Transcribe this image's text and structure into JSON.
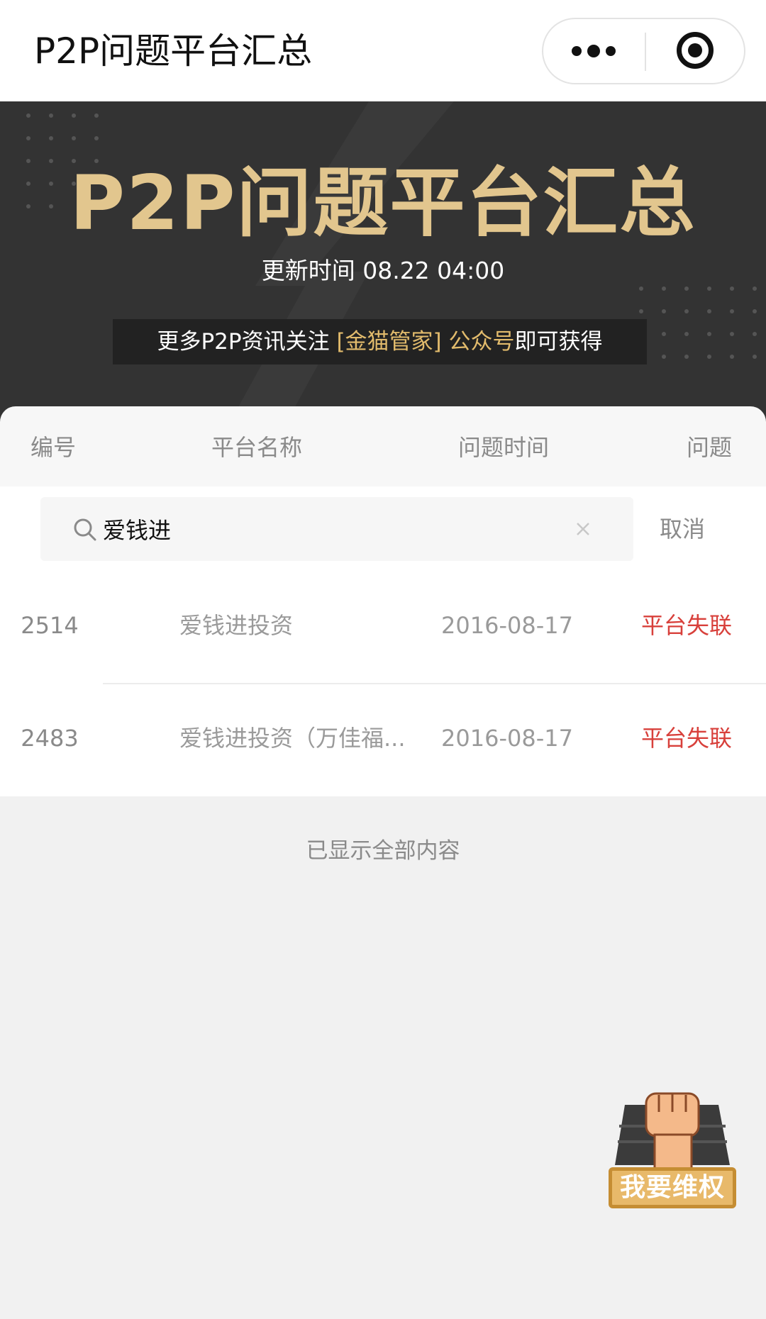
{
  "navbar": {
    "title": "P2P问题平台汇总"
  },
  "banner": {
    "title": "P2P问题平台汇总",
    "update_time": "更新时间 08.22 04:00",
    "notice_prefix": "更多P2P资讯关注",
    "notice_highlight": " [金猫管家] 公众号",
    "notice_suffix": "即可获得",
    "title_color": "#e2c68e",
    "highlight_color": "#e2bb6c"
  },
  "table": {
    "columns": [
      "编号",
      "平台名称",
      "问题时间",
      "问题"
    ]
  },
  "search": {
    "value": "爱钱进",
    "cancel_label": "取消"
  },
  "results": [
    {
      "id": "2514",
      "name": "爱钱进投资",
      "date": "2016-08-17",
      "status": "平台失联"
    },
    {
      "id": "2483",
      "name": "爱钱进投资（万佳福...",
      "date": "2016-08-17",
      "status": "平台失联"
    }
  ],
  "end_text": "已显示全部内容",
  "rights_button": {
    "label": "我要维权"
  },
  "colors": {
    "status_red": "#d8403b",
    "banner_bg": "#333333",
    "page_bg": "#f1f1f1"
  }
}
